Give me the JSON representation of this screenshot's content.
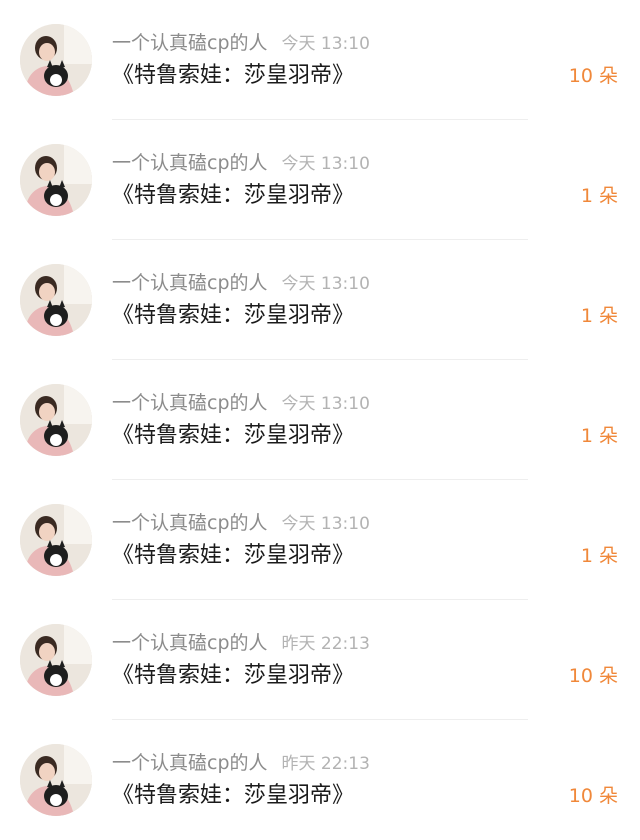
{
  "colors": {
    "accent": "#f0883a",
    "username": "#8c8c8c",
    "time": "#b3b3b3",
    "title": "#1a1a1a",
    "divider": "#eeeeee"
  },
  "items": [
    {
      "username": "一个认真磕cp的人",
      "time": "今天 13:10",
      "title": "《特鲁索娃：莎皇羽帝》",
      "count": "10 朵"
    },
    {
      "username": "一个认真磕cp的人",
      "time": "今天 13:10",
      "title": "《特鲁索娃：莎皇羽帝》",
      "count": "1 朵"
    },
    {
      "username": "一个认真磕cp的人",
      "time": "今天 13:10",
      "title": "《特鲁索娃：莎皇羽帝》",
      "count": "1 朵"
    },
    {
      "username": "一个认真磕cp的人",
      "time": "今天 13:10",
      "title": "《特鲁索娃：莎皇羽帝》",
      "count": "1 朵"
    },
    {
      "username": "一个认真磕cp的人",
      "time": "今天 13:10",
      "title": "《特鲁索娃：莎皇羽帝》",
      "count": "1 朵"
    },
    {
      "username": "一个认真磕cp的人",
      "time": "昨天 22:13",
      "title": "《特鲁索娃：莎皇羽帝》",
      "count": "10 朵"
    },
    {
      "username": "一个认真磕cp的人",
      "time": "昨天 22:13",
      "title": "《特鲁索娃：莎皇羽帝》",
      "count": "10 朵"
    }
  ]
}
